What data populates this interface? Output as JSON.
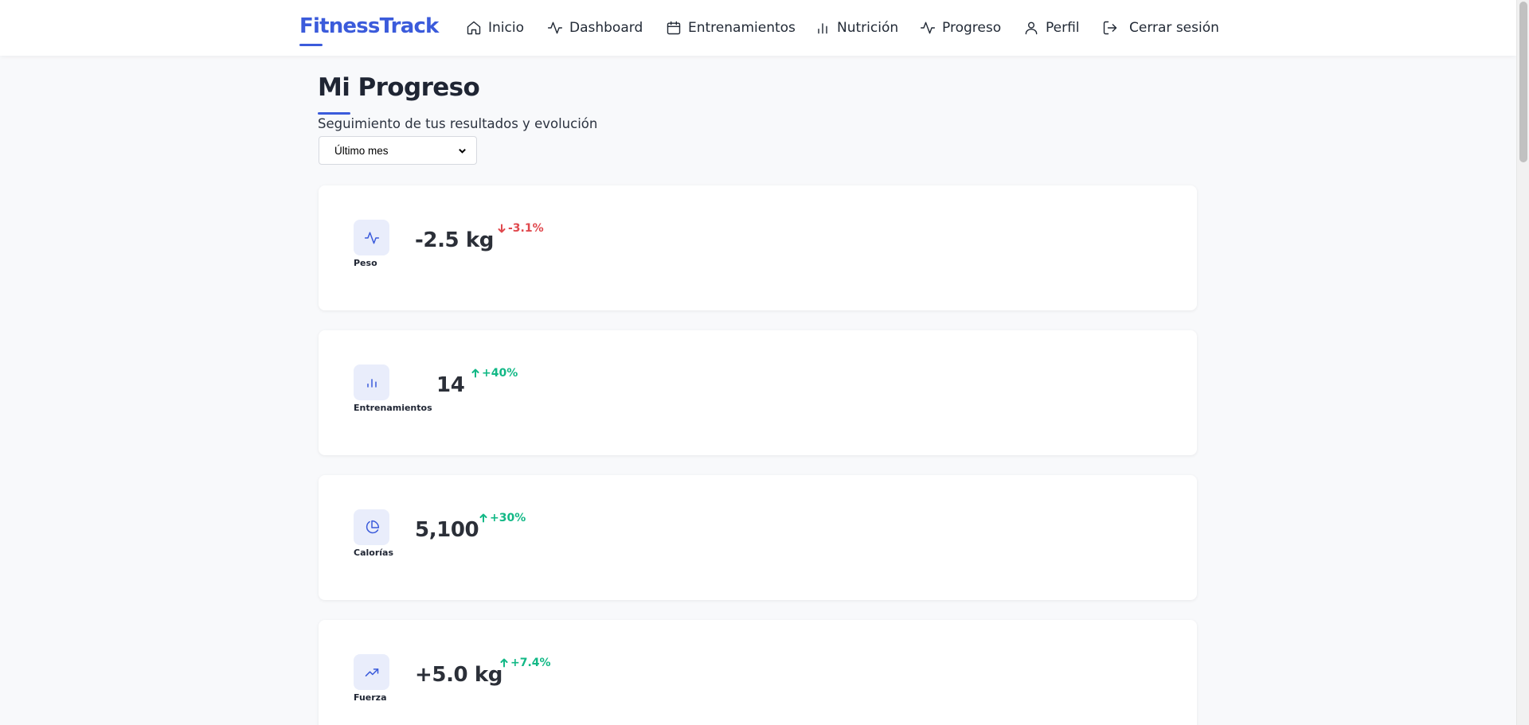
{
  "brand": "FitnessTrack",
  "nav": [
    {
      "label": "Inicio",
      "icon": "home-icon"
    },
    {
      "label": "Dashboard",
      "icon": "activity-icon"
    },
    {
      "label": "Entrenamientos",
      "icon": "calendar-icon"
    },
    {
      "label": "Nutrición",
      "icon": "bar-chart-icon"
    },
    {
      "label": "Progreso",
      "icon": "activity-icon"
    },
    {
      "label": "Perfil",
      "icon": "user-icon"
    },
    {
      "label": "Cerrar sesión",
      "icon": "logout-icon"
    }
  ],
  "page": {
    "title": "Mi Progreso",
    "subtitle": "Seguimiento de tus resultados y evolución",
    "period_select": {
      "selected": "Último mes"
    }
  },
  "stats": [
    {
      "label": "Peso",
      "value": "-2.5 kg",
      "change": "-3.1%",
      "trend": "down",
      "icon": "activity-icon"
    },
    {
      "label": "Entrenamientos",
      "value": "14",
      "change": "+40%",
      "trend": "up",
      "icon": "bar-chart-icon"
    },
    {
      "label": "Calorías",
      "value": "5,100",
      "change": "+30%",
      "trend": "up",
      "icon": "pie-chart-icon"
    },
    {
      "label": "Fuerza",
      "value": "+5.0 kg",
      "change": "+7.4%",
      "trend": "up",
      "icon": "trending-up-icon"
    }
  ],
  "colors": {
    "accent": "#3b5bdb",
    "negative": "#e0484d",
    "positive": "#12b886",
    "icon_bg": "#e9edfb",
    "page_bg": "#f8f9fb"
  }
}
